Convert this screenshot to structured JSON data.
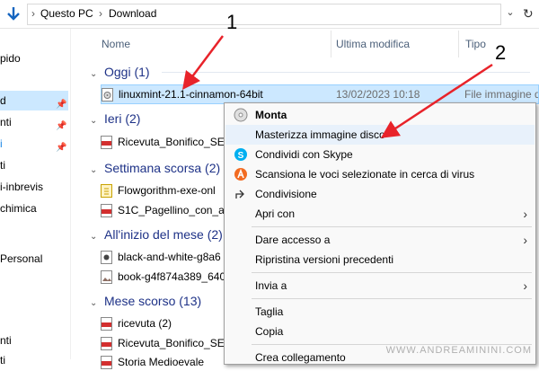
{
  "address": {
    "crumbs": [
      "Questo PC",
      "Download"
    ],
    "sep": "›"
  },
  "nav": {
    "items": [
      "pido",
      "d",
      "nti",
      "i",
      "ti",
      "i-inbrevis",
      "chimica",
      "Personal",
      "nti",
      "ti"
    ]
  },
  "columns": {
    "name": "Nome",
    "modified": "Ultima modifica",
    "type": "Tipo"
  },
  "groups": [
    {
      "label": "Oggi (1)"
    },
    {
      "label": "Ieri (2)"
    },
    {
      "label": "Settimana scorsa (2)"
    },
    {
      "label": "All'inizio del mese (2)"
    },
    {
      "label": "Mese scorso (13)"
    }
  ],
  "files": {
    "oggi": [
      {
        "name": "linuxmint-21.1-cinnamon-64bit",
        "modified": "13/02/2023 10:18",
        "type": "File immagine d"
      }
    ],
    "ieri": [
      {
        "name": "Ricevuta_Bonifico_SEP"
      }
    ],
    "settimana": [
      {
        "name": "Flowgorithm-exe-onl"
      },
      {
        "name": "S1C_Pagellino_con_as"
      }
    ],
    "mese": [
      {
        "name": "black-and-white-g8a6"
      },
      {
        "name": "book-g4f874a389_640"
      }
    ],
    "mesescorso": [
      {
        "name": "ricevuta (2)"
      },
      {
        "name": "Ricevuta_Bonifico_SEP"
      },
      {
        "name": "Storia Medioevale"
      }
    ]
  },
  "menu": {
    "items": [
      {
        "label": "Monta"
      },
      {
        "label": "Masterizza immagine disco"
      },
      {
        "label": "Condividi con Skype"
      },
      {
        "label": "Scansiona le voci selezionate in cerca di virus"
      },
      {
        "label": "Condivisione"
      },
      {
        "label": "Apri con"
      },
      {
        "label": "Dare accesso a"
      },
      {
        "label": "Ripristina versioni precedenti"
      },
      {
        "label": "Invia a"
      },
      {
        "label": "Taglia"
      },
      {
        "label": "Copia"
      },
      {
        "label": "Crea collegamento"
      }
    ],
    "submenu_glyph": "›"
  },
  "annotations": {
    "one": "1",
    "two": "2"
  },
  "watermark": "WWW.ANDREAMININI.COM",
  "colors": {
    "selection": "#cce8ff",
    "group_text": "#1e3287",
    "arrow": "#e8232a",
    "skype": "#00aff0",
    "avast": "#f26b21"
  },
  "icons": [
    "down-arrow-icon",
    "chevron-down-icon",
    "refresh-icon",
    "pin-icon",
    "disc-image-file-icon",
    "pdf-file-icon",
    "java-file-icon",
    "image-file-icon",
    "disc-icon",
    "skype-icon",
    "avast-icon",
    "share-icon",
    "submenu-arrow-icon"
  ]
}
